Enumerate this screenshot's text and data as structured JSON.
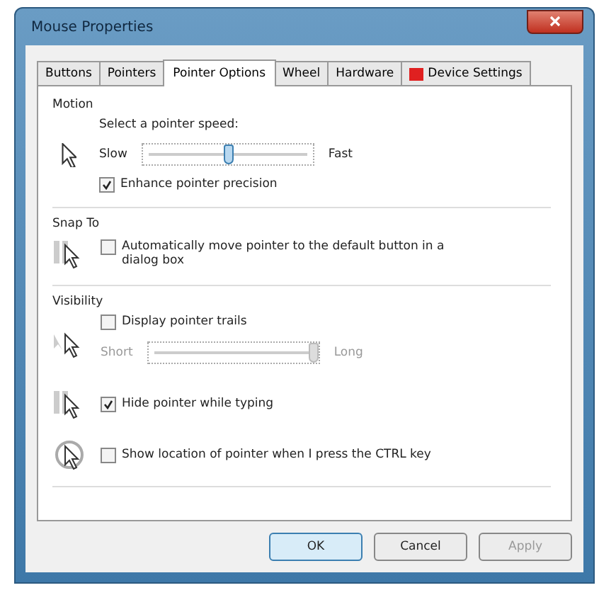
{
  "window": {
    "title": "Mouse Properties"
  },
  "tabs": [
    {
      "label": "Buttons",
      "selected": false
    },
    {
      "label": "Pointers",
      "selected": false
    },
    {
      "label": "Pointer Options",
      "selected": true
    },
    {
      "label": "Wheel",
      "selected": false
    },
    {
      "label": "Hardware",
      "selected": false
    },
    {
      "label": "Device Settings",
      "selected": false,
      "kind": "device"
    }
  ],
  "motion": {
    "heading": "Motion",
    "label": "Select a pointer speed:",
    "slow": "Slow",
    "fast": "Fast",
    "level": 0.5,
    "precision": {
      "label": "Enhance pointer precision",
      "checked": true
    }
  },
  "snap_to": {
    "heading": "Snap To",
    "option": {
      "label": "Automatically move pointer to the default button in a dialog box",
      "checked": false
    }
  },
  "visibility": {
    "heading": "Visibility",
    "trails": {
      "label": "Display pointer trails",
      "checked": false
    },
    "short": "Short",
    "long": "Long",
    "trail_slider": {
      "level": 1
    },
    "hide": {
      "label": "Hide pointer while typing",
      "checked": true
    },
    "ctrl": {
      "label": "Show location of pointer when I press the CTRL key",
      "checked": false
    }
  },
  "buttons": [
    {
      "label": "OK",
      "disabled": false,
      "default": true
    },
    {
      "label": "Cancel",
      "disabled": false,
      "default": false
    },
    {
      "label": "Apply",
      "disabled": true,
      "default": false
    }
  ]
}
